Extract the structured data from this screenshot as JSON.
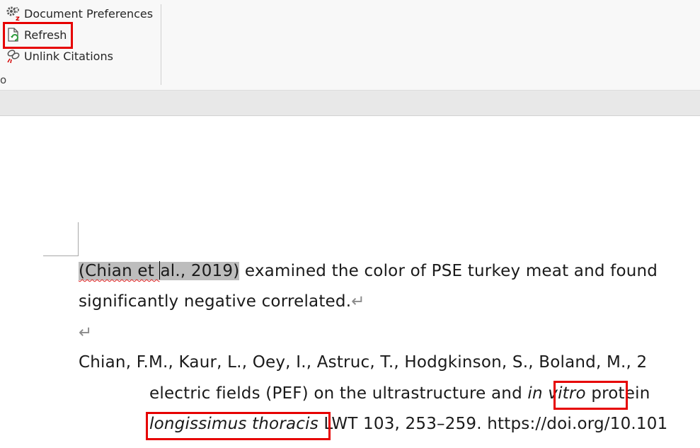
{
  "ribbon": {
    "document_preferences": {
      "label": "Document Preferences",
      "icon": "gear-icon"
    },
    "refresh": {
      "label": "Refresh",
      "icon": "refresh-document-icon"
    },
    "unlink_citations": {
      "label": "Unlink Citations",
      "icon": "unlink-icon"
    },
    "group_label_fragment": "o"
  },
  "document": {
    "para1": {
      "citation_before_caret": "(Chian et ",
      "citation_after_caret": "al., 2019)",
      "rest": " examined the color of PSE turkey meat and found"
    },
    "para2": {
      "text": "significantly negative correlated.",
      "mark": "↵"
    },
    "empty_para_mark": "↵",
    "reference": {
      "line1": "Chian, F.M., Kaur, L., Oey, I., Astruc, T., Hodgkinson, S., Boland, M., 2",
      "line2_before": "electric fields (PEF) on the ultrastructure and ",
      "line2_italic": "in vitro",
      "line2_after": " protein",
      "line3_italic": "longissimus thoracis",
      "line3_after": " LWT 103, 253–259. https://doi.org/10.101"
    }
  },
  "colors": {
    "highlight_box": "#e60000",
    "field_shading": "#bdbdbd",
    "spell_squiggle": "#e02020"
  }
}
